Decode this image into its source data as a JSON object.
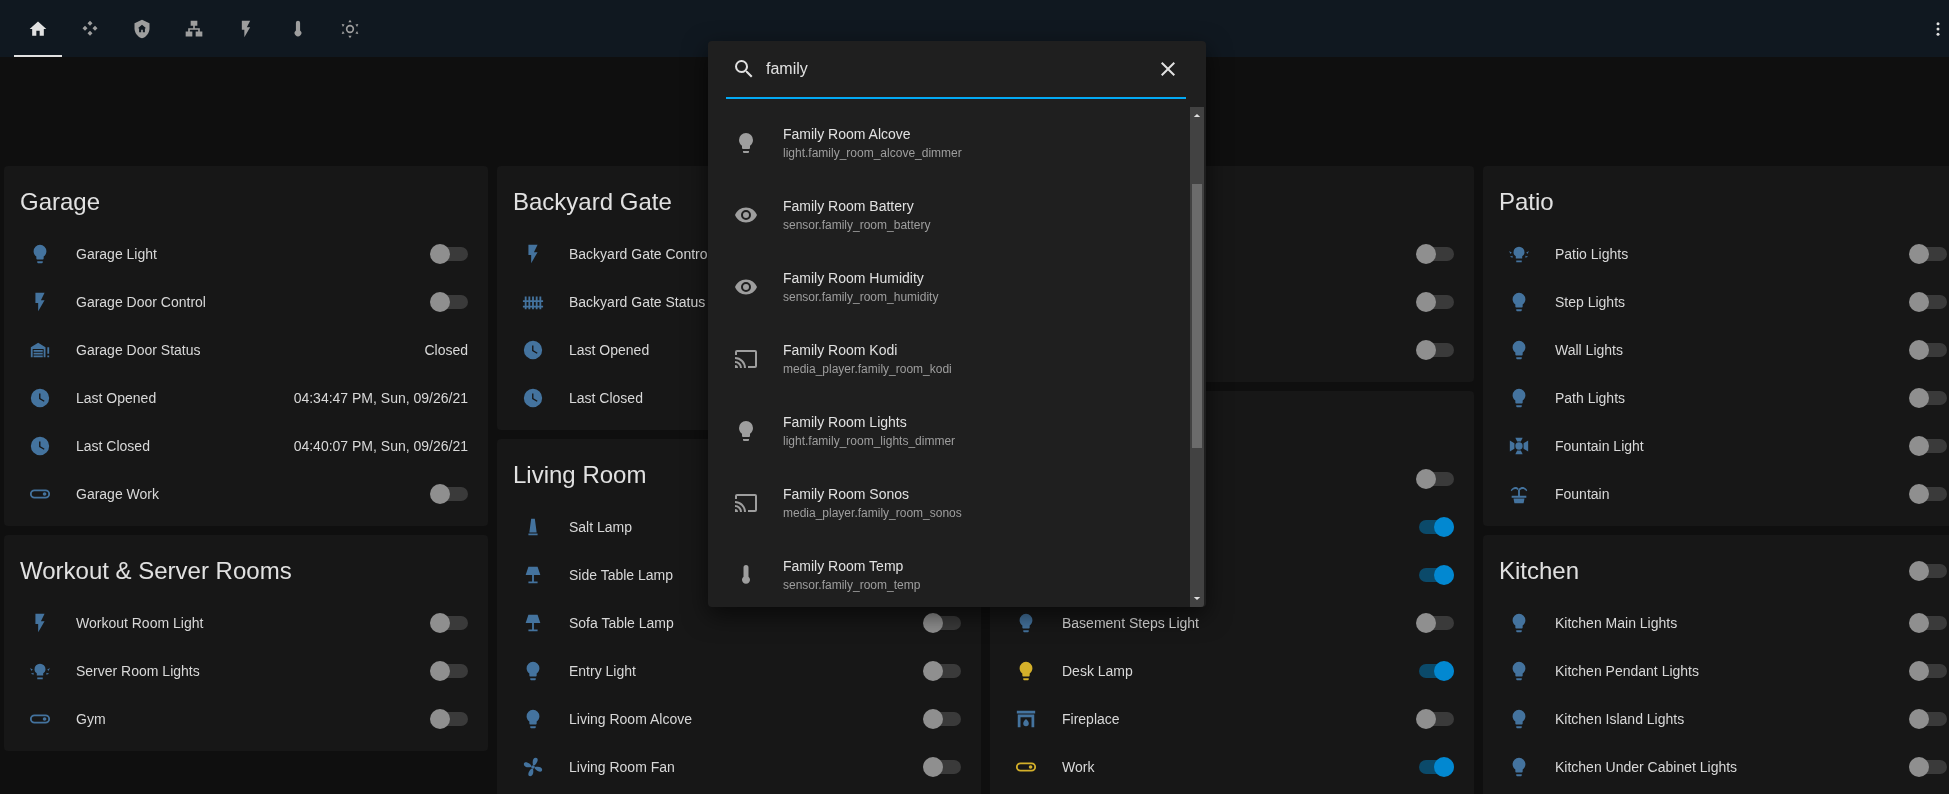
{
  "tabs": [
    {
      "kind": "home",
      "selected": true
    },
    {
      "kind": "kodi",
      "selected": false
    },
    {
      "kind": "shield-home",
      "selected": false
    },
    {
      "kind": "network",
      "selected": false
    },
    {
      "kind": "flash",
      "selected": false
    },
    {
      "kind": "thermometer",
      "selected": false
    },
    {
      "kind": "brightness",
      "selected": false
    }
  ],
  "columns": [
    {
      "cards": [
        {
          "title": "Garage",
          "rows": [
            {
              "kind": "bulb",
              "name": "Garage Light",
              "on": false
            },
            {
              "kind": "flash",
              "name": "Garage Door Control",
              "on": false
            },
            {
              "kind": "garage",
              "name": "Garage Door Status",
              "value": "Closed"
            },
            {
              "kind": "clock",
              "name": "Last Opened",
              "value": "04:34:47 PM, Sun, 09/26/21"
            },
            {
              "kind": "clock",
              "name": "Last Closed",
              "value": "04:40:07 PM, Sun, 09/26/21"
            },
            {
              "kind": "switch",
              "name": "Garage Work",
              "on": false
            }
          ]
        },
        {
          "title": "Workout & Server Rooms",
          "rows": [
            {
              "kind": "flash",
              "name": "Workout Room Light",
              "on": false
            },
            {
              "kind": "ceiling-light",
              "name": "Server Room Lights",
              "on": false
            },
            {
              "kind": "switch",
              "name": "Gym",
              "on": false
            }
          ]
        }
      ]
    },
    {
      "cards": [
        {
          "title": "Backyard Gate",
          "rows": [
            {
              "kind": "flash",
              "name": "Backyard Gate Contro"
            },
            {
              "kind": "fence",
              "name": "Backyard Gate Status"
            },
            {
              "kind": "clock",
              "name": "Last Opened"
            },
            {
              "kind": "clock",
              "name": "Last Closed"
            }
          ]
        },
        {
          "title": "Living Room",
          "rows": [
            {
              "kind": "salt-lamp",
              "name": "Salt Lamp"
            },
            {
              "kind": "table-lamp",
              "name": "Side Table Lamp"
            },
            {
              "kind": "table-lamp",
              "name": "Sofa Table Lamp",
              "on": false
            },
            {
              "kind": "bulb",
              "name": "Entry Light",
              "on": false
            },
            {
              "kind": "bulb",
              "name": "Living Room Alcove",
              "on": false
            },
            {
              "kind": "fan",
              "name": "Living Room Fan",
              "on": false
            }
          ]
        }
      ]
    },
    {
      "cards": [
        {
          "rows": [
            {
              "on": false
            },
            {
              "on": false
            },
            {
              "on": false
            }
          ]
        },
        {
          "rows": [
            {
              "on": false
            },
            {
              "on": true
            },
            {
              "on": true
            },
            {
              "kind": "bulb",
              "name": "Basement Steps Light",
              "on": false
            },
            {
              "kind": "bulb",
              "name": "Desk Lamp",
              "on": true
            },
            {
              "kind": "fireplace",
              "name": "Fireplace",
              "on": false
            },
            {
              "kind": "switch",
              "name": "Work",
              "on": true
            }
          ]
        }
      ]
    },
    {
      "cards": [
        {
          "title": "Patio",
          "rows": [
            {
              "kind": "ceiling-light",
              "name": "Patio Lights",
              "on": false
            },
            {
              "kind": "bulb",
              "name": "Step Lights",
              "on": false
            },
            {
              "kind": "bulb",
              "name": "Wall Lights",
              "on": false
            },
            {
              "kind": "bulb",
              "name": "Path Lights",
              "on": false
            },
            {
              "kind": "spotlight",
              "name": "Fountain Light",
              "on": false
            },
            {
              "kind": "fountain",
              "name": "Fountain",
              "on": false
            }
          ]
        },
        {
          "title": "Kitchen",
          "on": false,
          "rows": [
            {
              "kind": "bulb",
              "name": "Kitchen Main Lights",
              "on": false
            },
            {
              "kind": "bulb",
              "name": "Kitchen Pendant Lights",
              "on": false
            },
            {
              "kind": "bulb",
              "name": "Kitchen Island Lights",
              "on": false
            },
            {
              "kind": "bulb",
              "name": "Kitchen Under Cabinet Lights",
              "on": false
            }
          ]
        }
      ]
    }
  ],
  "search": {
    "value": "family",
    "results": [
      {
        "kind": "bulb",
        "name": "Family Room Alcove",
        "entity": "light.family_room_alcove_dimmer"
      },
      {
        "kind": "eye",
        "name": "Family Room Battery",
        "entity": "sensor.family_room_battery"
      },
      {
        "kind": "eye",
        "name": "Family Room Humidity",
        "entity": "sensor.family_room_humidity"
      },
      {
        "kind": "cast",
        "name": "Family Room Kodi",
        "entity": "media_player.family_room_kodi"
      },
      {
        "kind": "bulb",
        "name": "Family Room Lights",
        "entity": "light.family_room_lights_dimmer"
      },
      {
        "kind": "cast",
        "name": "Family Room Sonos",
        "entity": "media_player.family_room_sonos"
      },
      {
        "kind": "thermometer",
        "name": "Family Room Temp",
        "entity": "sensor.family_room_temp"
      }
    ]
  }
}
